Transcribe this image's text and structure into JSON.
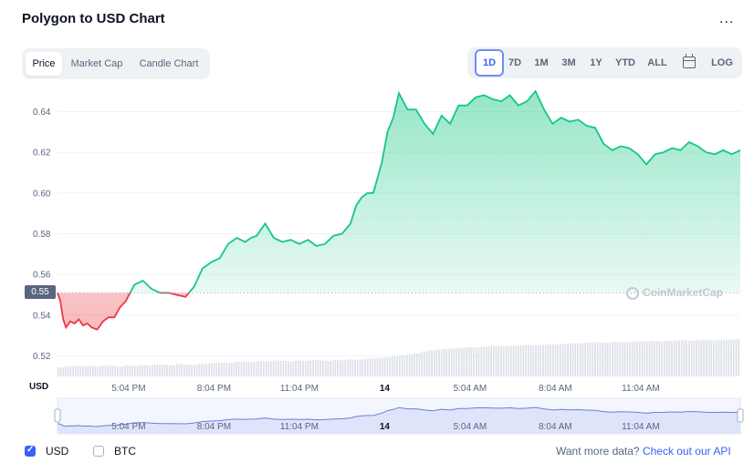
{
  "title": "Polygon to USD Chart",
  "more_menu": "...",
  "tabs": [
    "Price",
    "Market Cap",
    "Candle Chart"
  ],
  "active_tab": "Price",
  "ranges": [
    "1D",
    "7D",
    "1M",
    "3M",
    "1Y",
    "YTD",
    "ALL"
  ],
  "active_range": "1D",
  "log_label": "LOG",
  "colors": {
    "up": "#16c784",
    "down": "#ea3943",
    "accent": "#3861fb"
  },
  "current_price_tag": "0.55",
  "watermark": "CoinMarketCap",
  "currency_axis_label": "USD",
  "currencies": [
    {
      "label": "USD",
      "checked": true
    },
    {
      "label": "BTC",
      "checked": false
    }
  ],
  "api": {
    "prefix": "Want more data? ",
    "link": "Check out our API"
  },
  "chart_data": {
    "type": "area",
    "y_ticks": [
      "0.64",
      "0.62",
      "0.60",
      "0.58",
      "0.56",
      "0.54",
      "0.52"
    ],
    "ylim": [
      0.51,
      0.65
    ],
    "baseline": 0.551,
    "x_ticks": [
      "5:04 PM",
      "8:04 PM",
      "11:04 PM",
      "14",
      "5:04 AM",
      "8:04 AM",
      "11:04 AM"
    ],
    "x_ticks_bold": [
      "14"
    ],
    "t_range": [
      0,
      24
    ],
    "t_ticks": [
      2.5,
      5.5,
      8.5,
      11.5,
      14.5,
      17.5,
      20.5
    ],
    "t": [
      0,
      0.1,
      0.2,
      0.3,
      0.45,
      0.6,
      0.75,
      0.9,
      1.05,
      1.2,
      1.4,
      1.6,
      1.8,
      2.0,
      2.2,
      2.4,
      2.7,
      3.0,
      3.3,
      3.6,
      3.9,
      4.2,
      4.5,
      4.8,
      5.1,
      5.4,
      5.7,
      6.0,
      6.3,
      6.6,
      6.8,
      7.0,
      7.3,
      7.6,
      7.9,
      8.2,
      8.5,
      8.8,
      9.1,
      9.4,
      9.7,
      10.0,
      10.3,
      10.5,
      10.7,
      10.9,
      11.1,
      11.2,
      11.4,
      11.6,
      11.8,
      12.0,
      12.3,
      12.6,
      12.9,
      13.2,
      13.5,
      13.8,
      14.1,
      14.4,
      14.7,
      15.0,
      15.3,
      15.6,
      15.9,
      16.2,
      16.5,
      16.8,
      17.1,
      17.4,
      17.7,
      18.0,
      18.3,
      18.6,
      18.9,
      19.2,
      19.5,
      19.8,
      20.1,
      20.4,
      20.7,
      21.0,
      21.3,
      21.6,
      21.9,
      22.2,
      22.5,
      22.8,
      23.1,
      23.4,
      23.7,
      24.0
    ],
    "values": [
      0.551,
      0.547,
      0.538,
      0.534,
      0.537,
      0.536,
      0.538,
      0.535,
      0.536,
      0.534,
      0.533,
      0.537,
      0.539,
      0.539,
      0.544,
      0.547,
      0.555,
      0.557,
      0.553,
      0.551,
      0.551,
      0.55,
      0.549,
      0.554,
      0.563,
      0.566,
      0.568,
      0.575,
      0.578,
      0.576,
      0.578,
      0.579,
      0.585,
      0.578,
      0.576,
      0.577,
      0.575,
      0.577,
      0.574,
      0.575,
      0.579,
      0.58,
      0.585,
      0.594,
      0.598,
      0.6,
      0.6,
      0.605,
      0.615,
      0.63,
      0.637,
      0.649,
      0.641,
      0.641,
      0.634,
      0.629,
      0.638,
      0.634,
      0.643,
      0.643,
      0.647,
      0.648,
      0.646,
      0.645,
      0.648,
      0.643,
      0.645,
      0.65,
      0.641,
      0.634,
      0.637,
      0.635,
      0.636,
      0.633,
      0.632,
      0.624,
      0.621,
      0.623,
      0.622,
      0.619,
      0.614,
      0.619,
      0.62,
      0.622,
      0.621,
      0.625,
      0.623,
      0.62,
      0.619,
      0.621,
      0.619,
      0.621
    ],
    "volume": [
      0.18,
      0.2,
      0.21,
      0.2,
      0.21,
      0.2,
      0.22,
      0.21,
      0.2,
      0.22,
      0.21,
      0.23,
      0.22,
      0.24,
      0.23,
      0.22,
      0.25,
      0.24,
      0.23,
      0.25,
      0.26,
      0.27,
      0.28,
      0.27,
      0.29,
      0.3,
      0.29,
      0.31,
      0.3,
      0.32,
      0.31,
      0.3,
      0.32,
      0.31,
      0.33,
      0.32,
      0.31,
      0.33,
      0.32,
      0.34,
      0.33,
      0.35,
      0.36,
      0.37,
      0.38,
      0.4,
      0.42,
      0.44,
      0.46,
      0.5,
      0.52,
      0.54,
      0.55,
      0.56,
      0.57,
      0.58,
      0.58,
      0.59,
      0.6,
      0.61,
      0.6,
      0.61,
      0.62,
      0.63,
      0.62,
      0.63,
      0.64,
      0.64,
      0.65,
      0.66,
      0.66,
      0.67,
      0.68,
      0.67,
      0.68,
      0.69,
      0.68,
      0.69,
      0.7,
      0.7,
      0.71,
      0.7,
      0.71,
      0.72,
      0.72,
      0.71,
      0.72,
      0.73,
      0.72,
      0.73,
      0.73,
      0.74
    ]
  }
}
